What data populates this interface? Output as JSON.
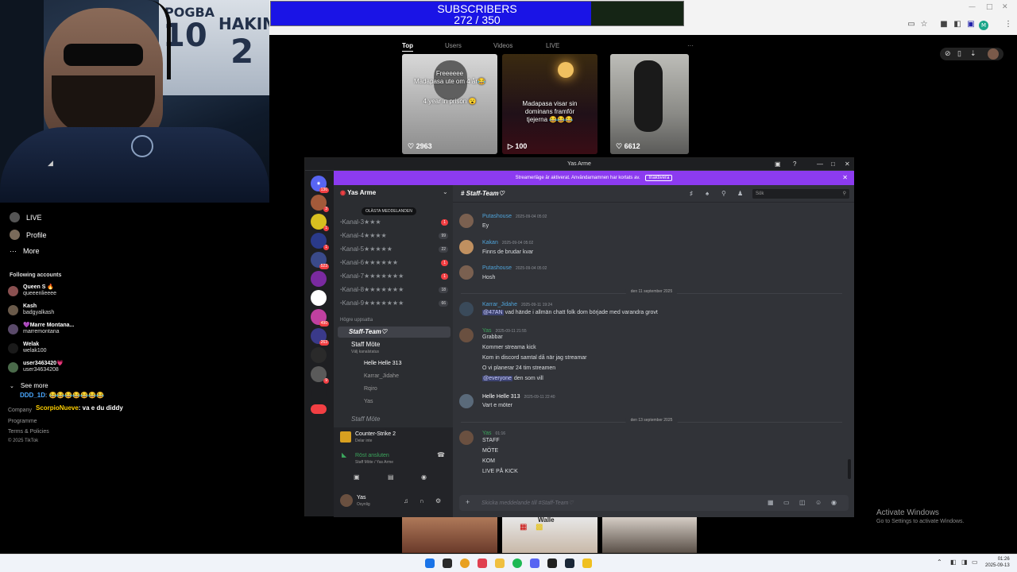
{
  "subscribers": {
    "title": "SUBSCRIBERS",
    "count": "272 / 350",
    "progress": 0.777
  },
  "webcam": {
    "jersey_name_1": "POGBA",
    "jersey_num_1": "10",
    "jersey_name_2": "HAKIMI",
    "jersey_num_2": "2"
  },
  "tiktok": {
    "tabs": [
      "Top",
      "Users",
      "Videos",
      "LIVE",
      "···"
    ],
    "thumbs": [
      {
        "caption1": "Freeeeee",
        "caption2": "Madapasa ute om 4 år😂",
        "caption3": "4 year in prison 😮",
        "likes": "2963"
      },
      {
        "caption1": "Madapasa visar sin",
        "caption2": "dominans framför",
        "caption3": "tjejerna 😂😂😂",
        "likes": "100"
      },
      {
        "caption1": "",
        "caption2": "",
        "caption3": "",
        "likes": "6612"
      }
    ],
    "bottom_caption": "Walle",
    "sidebar": {
      "live": "LIVE",
      "profile": "Profile",
      "more": "More",
      "following_header": "Following accounts",
      "see_more": "See more",
      "company": "Company",
      "programme": "Programme",
      "terms": "Terms & Policies",
      "copyright": "© 2025 TikTok"
    },
    "accounts": [
      {
        "name": "Queen S 🔥",
        "handle": "queeenlieeee"
      },
      {
        "name": "Kash",
        "handle": "badgyalkash"
      },
      {
        "name": "💜Marre Montana...",
        "handle": "marremontana"
      },
      {
        "name": "Welak",
        "handle": "welak100"
      },
      {
        "name": "user3463420💗",
        "handle": "user34634208"
      }
    ],
    "chat": [
      {
        "user": "DDD_1D",
        "text": ": 😂😂😂😂😂😂😂"
      },
      {
        "user": "ScorpioNueve",
        "text": ": va e du diddy"
      }
    ]
  },
  "discord": {
    "window_title": "Yas Arme",
    "banner": "Streamerläge är aktiverat. Användarnamnen har kortats av.",
    "banner_button": "Inaktivera",
    "server_name": "Yas Arme",
    "unread_pill": "OLÄSTA MEDDELANDEN",
    "channels": [
      {
        "name": "ꞏKanal-3★★★",
        "badge": "1",
        "grey": false
      },
      {
        "name": "ꞏKanal-4★★★★",
        "badge": "99",
        "grey": true
      },
      {
        "name": "ꞏKanal-5★★★★★",
        "badge": "22",
        "grey": true
      },
      {
        "name": "ꞏKanal-6★★★★★★",
        "badge": "1",
        "grey": false
      },
      {
        "name": "ꞏKanal-7★★★★★★★",
        "badge": "1",
        "grey": false
      },
      {
        "name": "ꞏKanal-8★★★★★★★",
        "badge": "18",
        "grey": true
      },
      {
        "name": "ꞏKanal-9★★★★★★★",
        "badge": "66",
        "grey": true
      }
    ],
    "category": "Högre uppsatta",
    "staff_team": "Staff-Team♡",
    "staff_mote": "Staff Möte",
    "voice_status": "Välj kanalstatus",
    "voice_users": [
      "Helle Helle 313",
      "Karrar_Jidahe",
      "Rqiro",
      "Yas"
    ],
    "staff_mote_2": "Staff Möte",
    "game": "Counter-Strike 2",
    "game_sub": "Delar inte",
    "voice_connected": "Röst ansluten",
    "voice_path": "Staff Möte / Yas Arme",
    "user_name": "Yas",
    "user_status": "Osynlig",
    "channel_header": "Staff-Team♡",
    "search_placeholder": "Sök",
    "messages": [
      {
        "author": "Putashouse",
        "time": "2025-09-04 05:02",
        "lines": [
          "Ey"
        ],
        "color": "#4fa3d9"
      },
      {
        "author": "Kakan",
        "time": "2025-09-04 05:02",
        "lines": [
          "Finns de brudar kvar"
        ],
        "color": "#4fa3d9"
      },
      {
        "author": "Putashouse",
        "time": "2025-09-04 05:02",
        "lines": [
          "Hosh"
        ],
        "color": "#4fa3d9"
      },
      {
        "author": "Karrar_Jidahe",
        "time": "2025-09-11 19:24",
        "lines": [
          "vad hände i allmän chatt folk dom började med varandra grovt"
        ],
        "mention": "@47AN",
        "color": "#4fa3d9"
      },
      {
        "author": "Yas",
        "time": "2025-09-11 21:55",
        "lines": [
          "Grabbar",
          "Kommer streama kick",
          "Kom in discord samtal då när jag streamar",
          "O vi planerar 24 tim streamen",
          "den som vill"
        ],
        "mention_last": "@everyone",
        "color": "#3ba55c"
      },
      {
        "author": "Helle Helle 313",
        "time": "2025-09-11 22:40",
        "lines": [
          "Vart e möter"
        ],
        "color": "#ffffff"
      },
      {
        "author": "Yas",
        "time": "01:16",
        "lines": [
          "STAFF",
          "MÖTE",
          "KOM",
          "LIVE PÅ KICK"
        ],
        "color": "#3ba55c"
      }
    ],
    "dividers": [
      "den 11 september 2025",
      "den 13 september 2025"
    ],
    "composer_placeholder": "Skicka meddelande till #Staff-Team♡"
  },
  "windows": {
    "activate_title": "Activate Windows",
    "activate_sub": "Go to Settings to activate Windows.",
    "clock_time": "01:26",
    "clock_date": "2025-09-13"
  }
}
